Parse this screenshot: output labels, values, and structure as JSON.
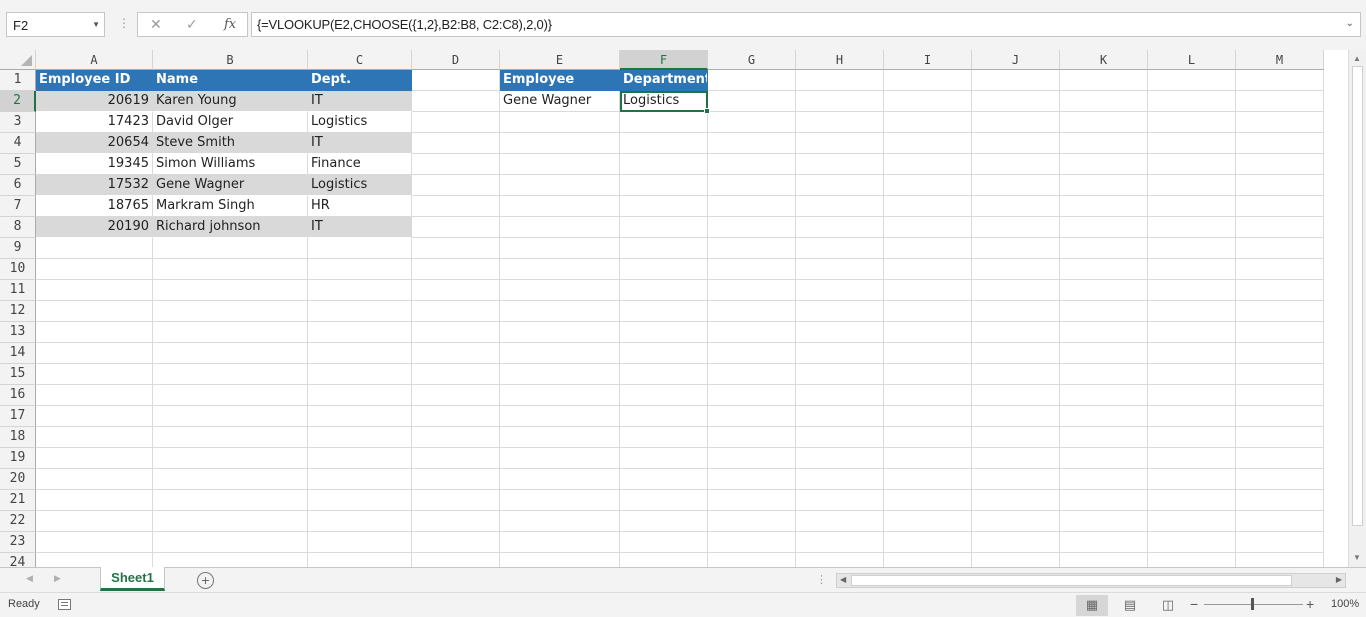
{
  "formula_bar": {
    "name_box": "F2",
    "cancel_icon": "✕",
    "enter_icon": "✓",
    "fx_label": "fx",
    "formula": "{=VLOOKUP(E2,CHOOSE({1,2},B2:B8, C2:C8),2,0)}"
  },
  "grid": {
    "columns": [
      "A",
      "B",
      "C",
      "D",
      "E",
      "F",
      "G",
      "H",
      "I",
      "J",
      "K",
      "L",
      "M"
    ],
    "selected_column": "F",
    "rows": [
      "1",
      "2",
      "3",
      "4",
      "5",
      "6",
      "7",
      "8",
      "9",
      "10",
      "11",
      "12",
      "13",
      "14",
      "15",
      "16",
      "17",
      "18",
      "19",
      "20",
      "21",
      "22",
      "23",
      "24"
    ],
    "selected_row": "2",
    "employee_table": {
      "headers": [
        "Employee ID",
        "Name",
        "Dept."
      ],
      "rows": [
        [
          "20619",
          "Karen Young",
          "IT"
        ],
        [
          "17423",
          "David Olger",
          "Logistics"
        ],
        [
          "20654",
          "Steve Smith",
          "IT"
        ],
        [
          "19345",
          "Simon Williams",
          "Finance"
        ],
        [
          "17532",
          "Gene Wagner",
          "Logistics"
        ],
        [
          "18765",
          "Markram Singh",
          "HR"
        ],
        [
          "20190",
          "Richard johnson",
          "IT"
        ]
      ]
    },
    "lookup_table": {
      "headers": [
        "Employee",
        "Department"
      ],
      "employee": "Gene Wagner",
      "department": "Logistics"
    },
    "colors": {
      "header_fill": "#2e75b6",
      "band_fill": "#d9d9d9",
      "selection": "#217346"
    }
  },
  "tabs": {
    "sheets": [
      "Sheet1"
    ],
    "active_sheet": "Sheet1",
    "add_sheet_icon": "+"
  },
  "status": {
    "mode": "Ready",
    "zoom": "100%",
    "zoom_minus": "−",
    "zoom_plus": "+"
  }
}
